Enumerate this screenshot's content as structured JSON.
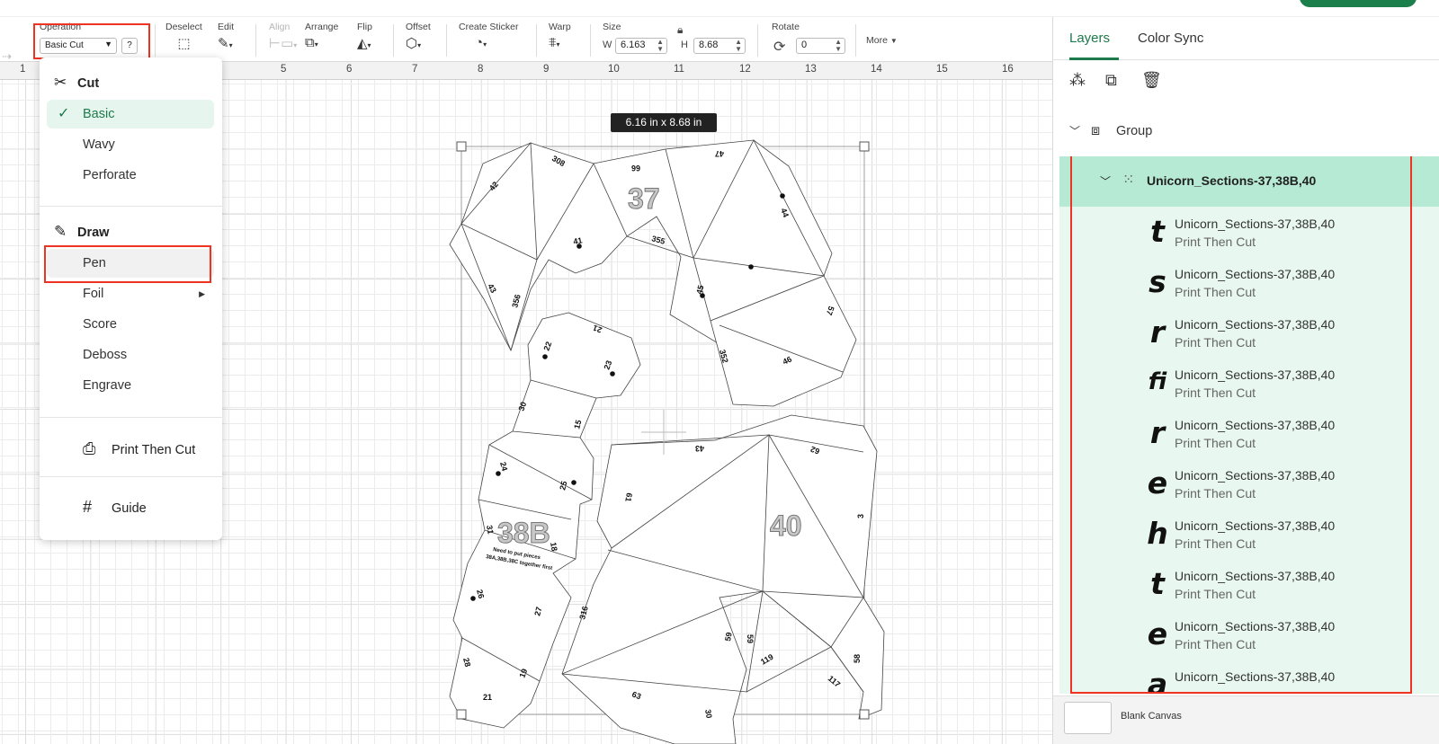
{
  "toolbar": {
    "operation_label": "Operation",
    "operation_value": "Basic Cut",
    "help_label": "?",
    "deselect_label": "Deselect",
    "edit_label": "Edit",
    "align_label": "Align",
    "arrange_label": "Arrange",
    "flip_label": "Flip",
    "offset_label": "Offset",
    "create_sticker_label": "Create Sticker",
    "warp_label": "Warp",
    "size_label": "Size",
    "w_label": "W",
    "w_value": "6.163",
    "h_label": "H",
    "h_value": "8.68",
    "rotate_label": "Rotate",
    "rotate_value": "0",
    "more_label": "More"
  },
  "ruler": [
    "1",
    "5",
    "6",
    "7",
    "8",
    "9",
    "10",
    "11",
    "12",
    "13",
    "14",
    "15",
    "16"
  ],
  "canvas": {
    "size_tooltip": "6.16  in x 8.68  in",
    "labels": {
      "p37": "37",
      "p38b": "38B",
      "p40": "40",
      "note1": "Need to put pieces",
      "note2": "38A,38B,38C together first",
      "n42": "42",
      "n308": "308",
      "n66": "66",
      "n47": "47",
      "n44": "44",
      "n41": "41",
      "n355": "355",
      "n43a": "43",
      "n356": "356",
      "n45": "45",
      "n57": "57",
      "n352": "352",
      "n46": "46",
      "n22": "22",
      "n21": "21",
      "n23": "23",
      "n30": "30",
      "n15": "15",
      "n24": "24",
      "n25": "25",
      "n31": "31",
      "n18": "18",
      "n26": "26",
      "n27": "27",
      "n28": "28",
      "n19": "19",
      "n21b": "21",
      "n43b": "43",
      "n62": "62",
      "n61": "61",
      "n3": "3",
      "n316": "316",
      "n59a": "59",
      "n59b": "59",
      "n119": "119",
      "n117": "117",
      "n58": "58",
      "n63": "63",
      "n30b": "30"
    }
  },
  "operation_menu": {
    "cut_header": "Cut",
    "cut_items": [
      "Basic",
      "Wavy",
      "Perforate"
    ],
    "selected": "Basic",
    "draw_header": "Draw",
    "draw_items": [
      "Pen",
      "Foil",
      "Score",
      "Deboss",
      "Engrave"
    ],
    "print_then_cut": "Print Then Cut",
    "guide": "Guide"
  },
  "panel": {
    "tabs": [
      "Layers",
      "Color Sync"
    ],
    "group_label": "Group",
    "layer_group_name": "Unicorn_Sections-37,38B,40",
    "layers": [
      {
        "glyph": "t",
        "name": "Unicorn_Sections-37,38B,40",
        "op": "Print Then Cut"
      },
      {
        "glyph": "s",
        "name": "Unicorn_Sections-37,38B,40",
        "op": "Print Then Cut"
      },
      {
        "glyph": "r",
        "name": "Unicorn_Sections-37,38B,40",
        "op": "Print Then Cut"
      },
      {
        "glyph": "fi",
        "name": "Unicorn_Sections-37,38B,40",
        "op": "Print Then Cut"
      },
      {
        "glyph": "r",
        "name": "Unicorn_Sections-37,38B,40",
        "op": "Print Then Cut"
      },
      {
        "glyph": "e",
        "name": "Unicorn_Sections-37,38B,40",
        "op": "Print Then Cut"
      },
      {
        "glyph": "h",
        "name": "Unicorn_Sections-37,38B,40",
        "op": "Print Then Cut"
      },
      {
        "glyph": "t",
        "name": "Unicorn_Sections-37,38B,40",
        "op": "Print Then Cut"
      },
      {
        "glyph": "e",
        "name": "Unicorn_Sections-37,38B,40",
        "op": "Print Then Cut"
      },
      {
        "glyph": "a",
        "name": "Unicorn_Sections-37,38B,40",
        "op": ""
      }
    ],
    "blank_canvas": "Blank Canvas"
  },
  "colors": {
    "accent": "#1d7a4a",
    "highlight": "#e32222",
    "layer_bg": "#e8f7f0",
    "layer_head_bg": "#b6ead4"
  }
}
